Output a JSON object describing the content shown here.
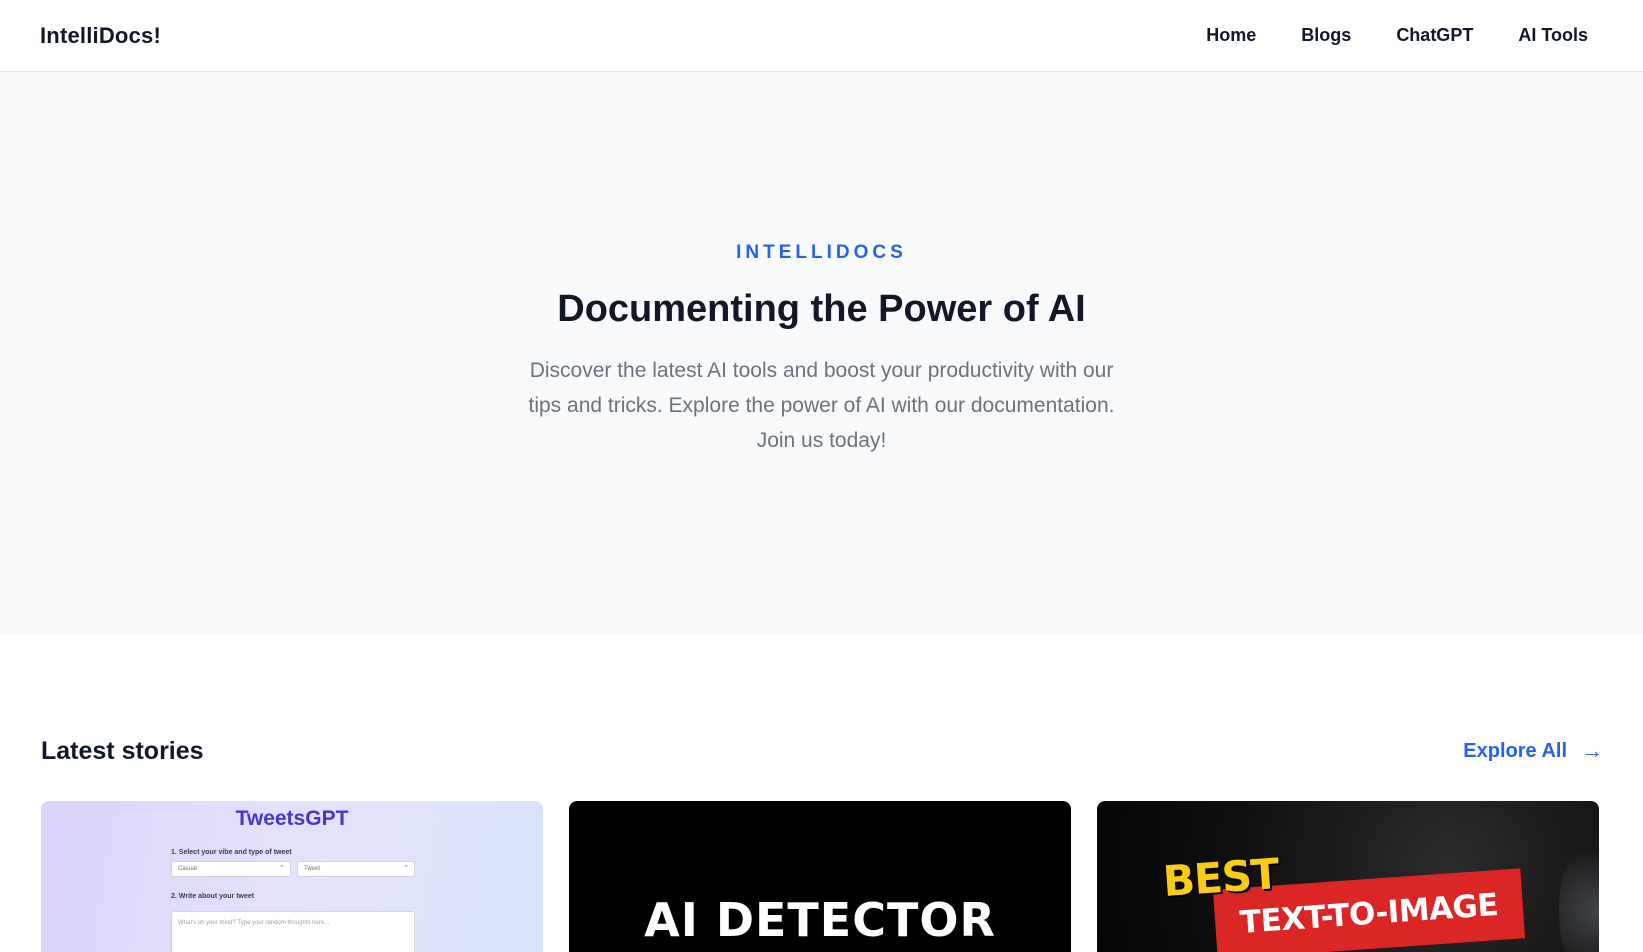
{
  "header": {
    "brand": "IntelliDocs!",
    "nav": [
      {
        "label": "Home"
      },
      {
        "label": "Blogs"
      },
      {
        "label": "ChatGPT"
      },
      {
        "label": "AI Tools"
      }
    ]
  },
  "hero": {
    "eyebrow": "INTELLIDOCS",
    "title": "Documenting the Power of AI",
    "description": "Discover the latest AI tools and boost your productivity with our tips and tricks. Explore the power of AI with our documentation. Join us today!"
  },
  "stories": {
    "title": "Latest stories",
    "explore_label": "Explore All",
    "explore_icon": "arrow-right-icon",
    "cards": [
      {
        "app_title": "TweetsGPT",
        "step1": "1. Select your vibe and type of tweet",
        "select1": "Casual",
        "select2": "Tweet",
        "step2": "2. Write about your tweet",
        "textarea_placeholder": "What's on your mind? Type your random thoughts here..."
      },
      {
        "headline": "AI DETECTOR"
      },
      {
        "headline_top": "BEST",
        "headline_box": "TEXT-TO-IMAGE"
      }
    ]
  },
  "colors": {
    "accent": "#2563eb",
    "hero_bg": "#f9fafb",
    "text_dark": "#111827",
    "text_muted": "#6b7280"
  }
}
